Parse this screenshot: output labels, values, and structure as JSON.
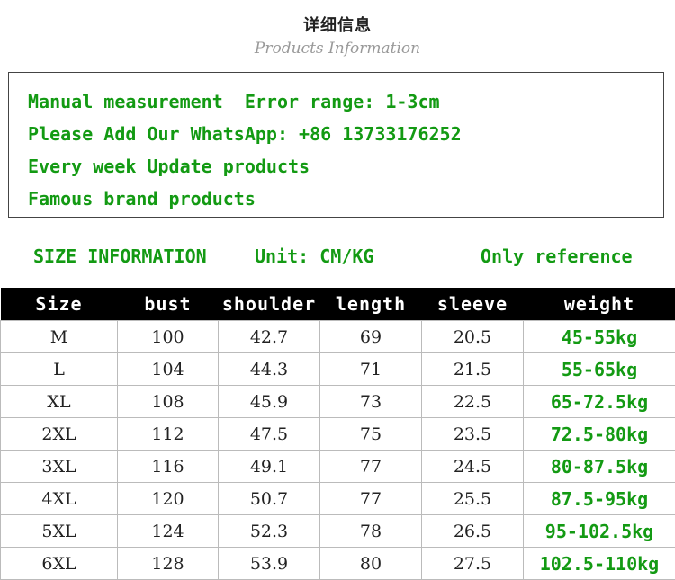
{
  "header": {
    "title_cn": "详细信息",
    "title_en": "Products Information"
  },
  "notes": [
    "Manual measurement  Error range: 1-3cm",
    "Please Add Our WhatsApp: +86 13733176252",
    "Every week Update products",
    "Famous brand products"
  ],
  "size_info": {
    "label": "SIZE INFORMATION",
    "unit": "Unit: CM/KG",
    "note": "Only reference"
  },
  "table": {
    "columns": [
      "Size",
      "bust",
      "shoulder",
      "length",
      "sleeve",
      "weight"
    ],
    "rows": [
      [
        "M",
        "100",
        "42.7",
        "69",
        "20.5",
        "45-55kg"
      ],
      [
        "L",
        "104",
        "44.3",
        "71",
        "21.5",
        "55-65kg"
      ],
      [
        "XL",
        "108",
        "45.9",
        "73",
        "22.5",
        "65-72.5kg"
      ],
      [
        "2XL",
        "112",
        "47.5",
        "75",
        "23.5",
        "72.5-80kg"
      ],
      [
        "3XL",
        "116",
        "49.1",
        "77",
        "24.5",
        "80-87.5kg"
      ],
      [
        "4XL",
        "120",
        "50.7",
        "77",
        "25.5",
        "87.5-95kg"
      ],
      [
        "5XL",
        "124",
        "52.3",
        "78",
        "26.5",
        "95-102.5kg"
      ],
      [
        "6XL",
        "128",
        "53.9",
        "80",
        "27.5",
        "102.5-110kg"
      ]
    ]
  },
  "colors": {
    "accent_green": "#139a13",
    "header_bg": "#000000"
  }
}
